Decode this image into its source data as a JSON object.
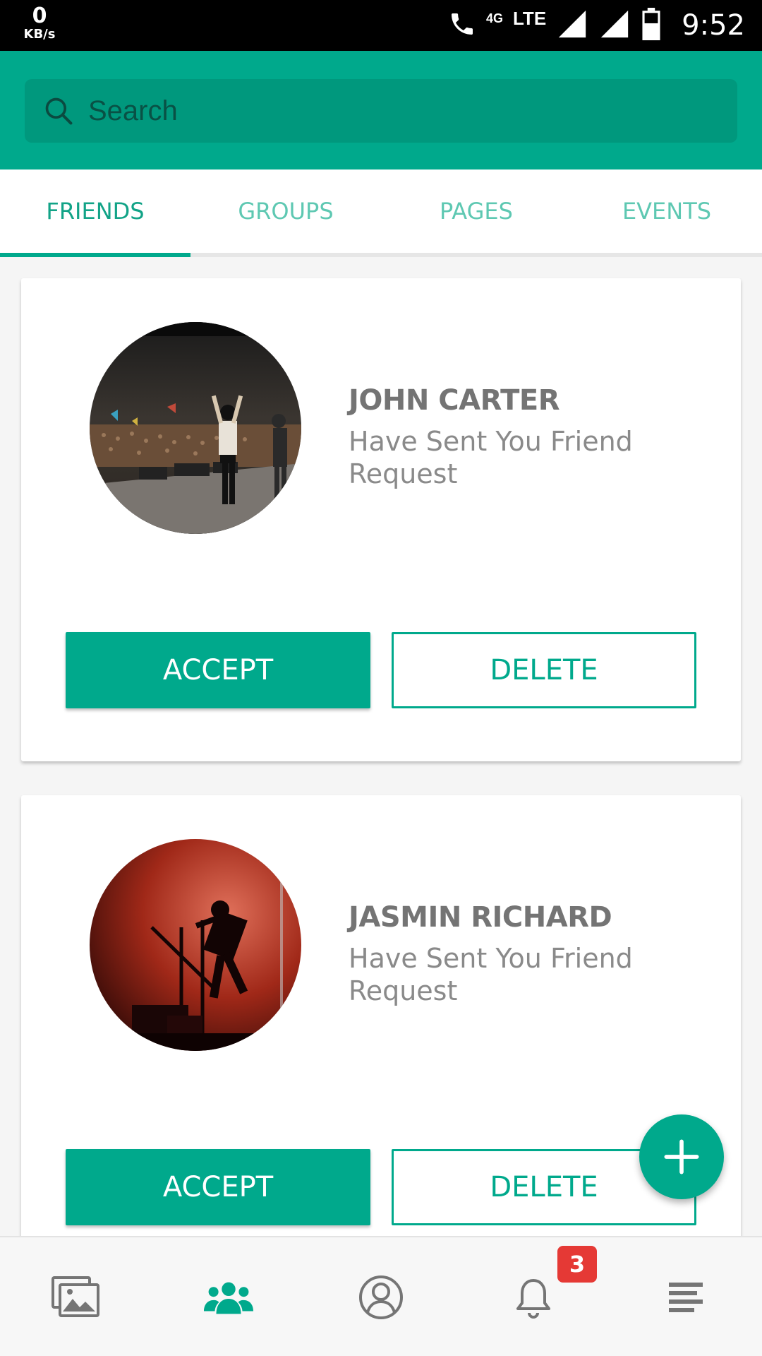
{
  "status_bar": {
    "net_speed_value": "0",
    "net_speed_unit": "KB/s",
    "network_small": "4G",
    "network": "LTE",
    "time": "9:52"
  },
  "search": {
    "placeholder": "Search"
  },
  "tabs": [
    {
      "label": "FRIENDS",
      "active": true
    },
    {
      "label": "GROUPS",
      "active": false
    },
    {
      "label": "PAGES",
      "active": false
    },
    {
      "label": "EVENTS",
      "active": false
    }
  ],
  "requests": [
    {
      "name": "JOHN CARTER",
      "message": "Have Sent You Friend Request",
      "accept_label": "ACCEPT",
      "delete_label": "DELETE"
    },
    {
      "name": "JASMIN RICHARD",
      "message": "Have Sent You Friend Request",
      "accept_label": "ACCEPT",
      "delete_label": "DELETE"
    }
  ],
  "fab_icon": "plus-icon",
  "bottom_nav": {
    "items": [
      "gallery-icon",
      "friends-icon",
      "profile-icon",
      "bell-icon",
      "menu-icon"
    ],
    "active": "friends-icon",
    "notification_count": "3"
  },
  "colors": {
    "accent": "#00a98c",
    "accent_dark": "#00987d",
    "badge": "#e53935",
    "status_bar": "#000000"
  }
}
